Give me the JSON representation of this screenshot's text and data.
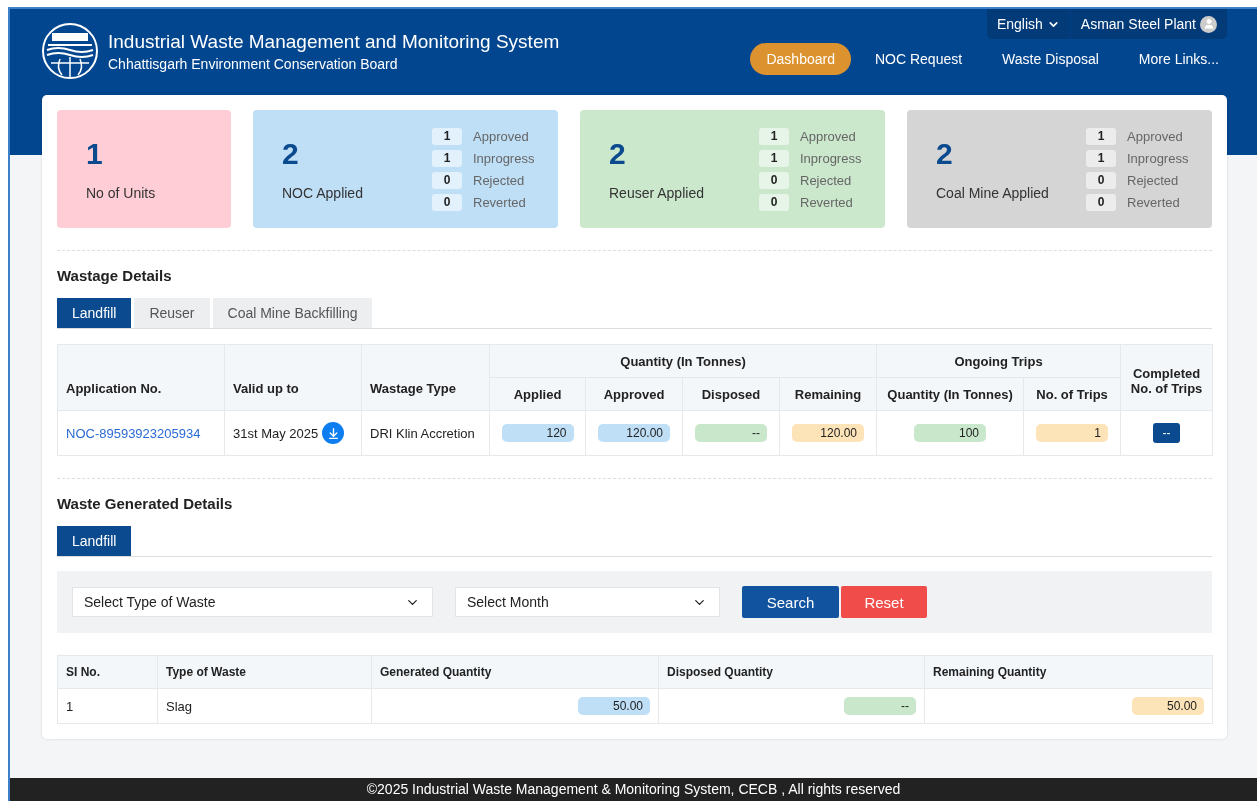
{
  "header": {
    "title": "Industrial Waste Management and Monitoring System",
    "subtitle": "Chhattisgarh Environment Conservation Board",
    "language": "English",
    "user": "Asman Steel Plant",
    "nav": [
      {
        "label": "Dashboard",
        "selected": true
      },
      {
        "label": "NOC Request",
        "selected": false
      },
      {
        "label": "Waste Disposal",
        "selected": false
      },
      {
        "label": "More Links...",
        "selected": false
      }
    ]
  },
  "stats": [
    {
      "value": "1",
      "label": "No of Units",
      "color": "#ffcdd6"
    },
    {
      "value": "2",
      "label": "NOC Applied",
      "color": "#bfdff7",
      "breakdown": [
        {
          "count": "1",
          "label": "Approved"
        },
        {
          "count": "1",
          "label": "Inprogress"
        },
        {
          "count": "0",
          "label": "Rejected"
        },
        {
          "count": "0",
          "label": "Reverted"
        }
      ]
    },
    {
      "value": "2",
      "label": "Reuser Applied",
      "color": "#cbe8cd",
      "breakdown": [
        {
          "count": "1",
          "label": "Approved"
        },
        {
          "count": "1",
          "label": "Inprogress"
        },
        {
          "count": "0",
          "label": "Rejected"
        },
        {
          "count": "0",
          "label": "Reverted"
        }
      ]
    },
    {
      "value": "2",
      "label": "Coal Mine Applied",
      "color": "#d5d5d5",
      "breakdown": [
        {
          "count": "1",
          "label": "Approved"
        },
        {
          "count": "1",
          "label": "Inprogress"
        },
        {
          "count": "0",
          "label": "Rejected"
        },
        {
          "count": "0",
          "label": "Reverted"
        }
      ]
    }
  ],
  "wastage": {
    "title": "Wastage Details",
    "tabs": [
      {
        "label": "Landfill",
        "selected": true
      },
      {
        "label": "Reuser",
        "selected": false
      },
      {
        "label": "Coal Mine Backfilling",
        "selected": false
      }
    ],
    "header_rows": [
      [
        {
          "text": "Application No.",
          "rowspan": 2
        },
        {
          "text": "Valid up to",
          "rowspan": 2
        },
        {
          "text": "Wastage Type",
          "rowspan": 2
        },
        {
          "text": "Quantity (In Tonnes)",
          "colspan": 4
        },
        {
          "text": "Ongoing Trips",
          "colspan": 2
        },
        {
          "text": "Completed No. of Trips",
          "rowspan": 2
        }
      ],
      [
        {
          "text": "Applied"
        },
        {
          "text": "Approved"
        },
        {
          "text": "Disposed"
        },
        {
          "text": "Remaining"
        },
        {
          "text": "Quantity (In Tonnes)"
        },
        {
          "text": "No. of Trips"
        }
      ]
    ],
    "rows": [
      [
        {
          "kind": "link",
          "text": "NOC-89593923205934"
        },
        {
          "kind": "date",
          "text": "31st May 2025"
        },
        {
          "kind": "text",
          "text": "DRI Klin Accretion"
        },
        {
          "kind": "pill",
          "text": "120",
          "color": "#bfdff7"
        },
        {
          "kind": "pill",
          "text": "120.00",
          "color": "#bfdff7"
        },
        {
          "kind": "pill",
          "text": "--",
          "color": "#c9e7cb"
        },
        {
          "kind": "pill",
          "text": "120.00",
          "color": "#fde3b8"
        },
        {
          "kind": "pill",
          "text": "100",
          "color": "#c9e7cb"
        },
        {
          "kind": "pill",
          "text": "1",
          "color": "#fde3b8"
        },
        {
          "kind": "button",
          "text": "--"
        }
      ]
    ]
  },
  "generated": {
    "title": "Waste Generated Details",
    "tabs": [
      {
        "label": "Landfill",
        "selected": true
      }
    ],
    "filters": [
      {
        "placeholder": "Select Type of Waste"
      },
      {
        "placeholder": "Select Month"
      }
    ],
    "buttons": [
      {
        "label": "Search",
        "kind": "primary"
      },
      {
        "label": "Reset",
        "kind": "danger"
      }
    ],
    "columns": [
      "SI No.",
      "Type of Waste",
      "Generated Quantity",
      "Disposed Quantity",
      "Remaining Quantity"
    ],
    "rows": [
      [
        {
          "kind": "text",
          "text": "1"
        },
        {
          "kind": "text",
          "text": "Slag"
        },
        {
          "kind": "pill",
          "text": "50.00",
          "color": "#bfdff7"
        },
        {
          "kind": "pill",
          "text": "--",
          "color": "#c9e7cb"
        },
        {
          "kind": "pill",
          "text": "50.00",
          "color": "#fde3b8"
        }
      ]
    ]
  },
  "footer": "©2025 Industrial Waste Management & Monitoring System, CECB , All rights reserved"
}
